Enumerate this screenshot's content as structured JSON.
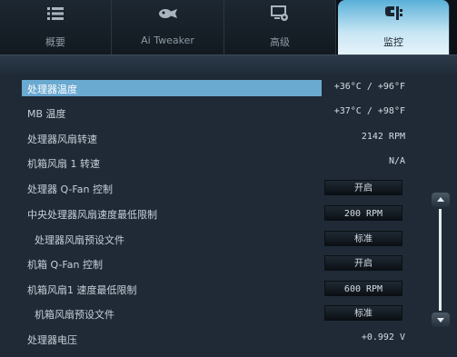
{
  "tabs": [
    {
      "label": "概要",
      "icon": "list-icon"
    },
    {
      "label": "Ai Tweaker",
      "icon": "tweaker-icon"
    },
    {
      "label": "高级",
      "icon": "advanced-icon"
    },
    {
      "label": "监控",
      "icon": "monitor-icon",
      "active": true
    }
  ],
  "rows": [
    {
      "name": "处理器温度",
      "value": "+36°C / +96°F"
    },
    {
      "name": "MB 温度",
      "value": "+37°C / +98°F"
    },
    {
      "name": "处理器风扇转速",
      "value": "2142 RPM"
    },
    {
      "name": "机箱风扇 1 转速",
      "value": "N/A"
    },
    {
      "name": "处理器 Q-Fan 控制",
      "button": "开启"
    },
    {
      "name": "中央处理器风扇速度最低限制",
      "button": "200 RPM"
    },
    {
      "name": "处理器风扇预设文件",
      "button": "标准"
    },
    {
      "name": "机箱 Q-Fan 控制",
      "button": "开启"
    },
    {
      "name": "机箱风扇1 速度最低限制",
      "button": "600 RPM"
    },
    {
      "name": "机箱风扇预设文件",
      "button": "标准"
    },
    {
      "name": "处理器电压",
      "value": "+0.992 V"
    }
  ],
  "colors": {
    "highlight": "#6aa9d0",
    "active_tab": "#5ab0d8",
    "background": "#1f2a36"
  }
}
